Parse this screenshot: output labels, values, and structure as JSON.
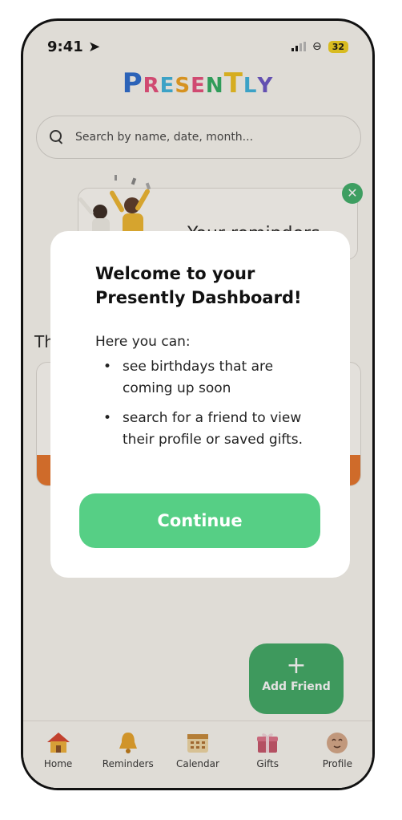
{
  "status_bar": {
    "time": "9:41",
    "battery": "32"
  },
  "logo": {
    "letters": [
      {
        "char": "P",
        "color": "#2b6cd0"
      },
      {
        "char": "R",
        "color": "#e94f7d"
      },
      {
        "char": "E",
        "color": "#3db5e0"
      },
      {
        "char": "S",
        "color": "#f0a21f"
      },
      {
        "char": "E",
        "color": "#e94f7d"
      },
      {
        "char": "N",
        "color": "#2fae62"
      },
      {
        "char": "T",
        "color": "#f0c21f"
      },
      {
        "char": "L",
        "color": "#3db5e0"
      },
      {
        "char": "Y",
        "color": "#6a55c8"
      }
    ]
  },
  "search": {
    "placeholder": "Search by name, date, month..."
  },
  "reminder_banner": {
    "text": "Your reminders"
  },
  "section": {
    "title": "Th"
  },
  "fab": {
    "plus": "+",
    "label": "Add Friend"
  },
  "tabs": [
    {
      "label": "Home",
      "icon": "home-icon"
    },
    {
      "label": "Reminders",
      "icon": "bell-icon"
    },
    {
      "label": "Calendar",
      "icon": "calendar-icon"
    },
    {
      "label": "Gifts",
      "icon": "gift-icon"
    },
    {
      "label": "Profile",
      "icon": "profile-icon"
    }
  ],
  "modal": {
    "title": "Welcome to your Presently Dashboard!",
    "intro": "Here you can:",
    "items": [
      "see birthdays that are coming up soon",
      "search for a friend to view their profile or saved gifts."
    ],
    "button": "Continue"
  },
  "colors": {
    "accent": "#56cf85",
    "fab": "#3faa66",
    "card_bar": "#e8752a",
    "close": "#3fb06a"
  }
}
